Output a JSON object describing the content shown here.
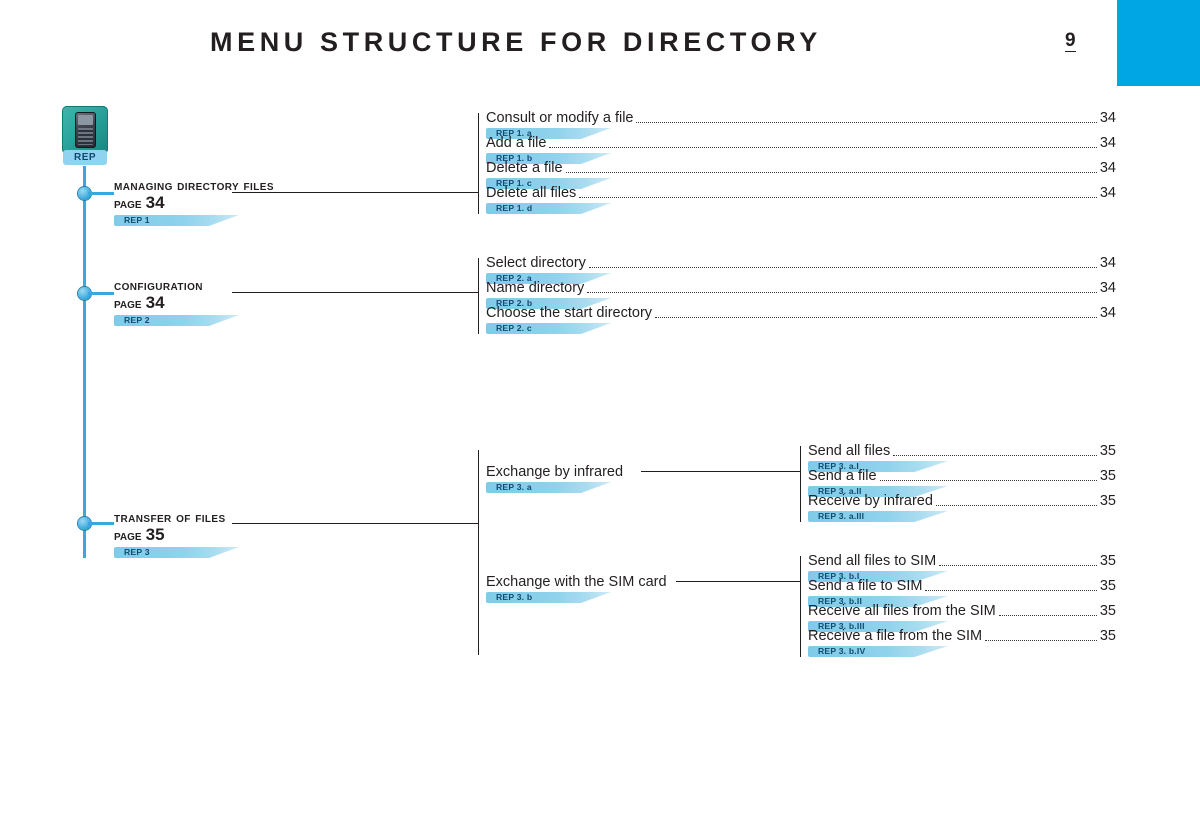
{
  "header": {
    "title": "MENU STRUCTURE FOR DIRECTORY",
    "page_number": "9",
    "accent_color": "#00a5e3"
  },
  "root": {
    "icon_name": "rep-device-icon",
    "label": "REP"
  },
  "branches": [
    {
      "title": "Managing directory files",
      "page_label": "Page",
      "page": "34",
      "tag": "REP 1",
      "leaves": [
        {
          "text": "Consult or modify a file",
          "page": "34",
          "tag": "REP 1. a"
        },
        {
          "text": "Add a file",
          "page": "34",
          "tag": "REP 1. b"
        },
        {
          "text": "Delete a file",
          "page": "34",
          "tag": "REP 1. c"
        },
        {
          "text": "Delete all files",
          "page": "34",
          "tag": "REP 1. d"
        }
      ]
    },
    {
      "title": "Configuration",
      "page_label": "Page",
      "page": "34",
      "tag": "REP 2",
      "leaves": [
        {
          "text": "Select directory",
          "page": "34",
          "tag": "REP 2. a"
        },
        {
          "text": "Name directory",
          "page": "34",
          "tag": "REP 2. b"
        },
        {
          "text": "Choose the start directory",
          "page": "34",
          "tag": "REP 2. c"
        }
      ]
    },
    {
      "title": "Transfer of files",
      "page_label": "Page",
      "page": "35",
      "tag": "REP 3",
      "groups": [
        {
          "text": "Exchange by infrared",
          "tag": "REP 3. a",
          "leaves": [
            {
              "text": "Send all files",
              "page": "35",
              "tag": "REP 3. a.I"
            },
            {
              "text": "Send a file",
              "page": "35",
              "tag": "REP 3. a.II"
            },
            {
              "text": "Receive by infrared",
              "page": "35",
              "tag": "REP 3. a.III"
            }
          ]
        },
        {
          "text": "Exchange with the SIM card",
          "tag": "REP 3. b",
          "leaves": [
            {
              "text": "Send all files to SIM",
              "page": "35",
              "tag": "REP 3. b.I"
            },
            {
              "text": "Send a file to SIM",
              "page": "35",
              "tag": "REP 3. b.II"
            },
            {
              "text": "Receive all files from the SIM",
              "page": "35",
              "tag": "REP 3. b.III"
            },
            {
              "text": "Receive a file from the SIM",
              "page": "35",
              "tag": "REP 3. b.IV"
            }
          ]
        }
      ]
    }
  ]
}
